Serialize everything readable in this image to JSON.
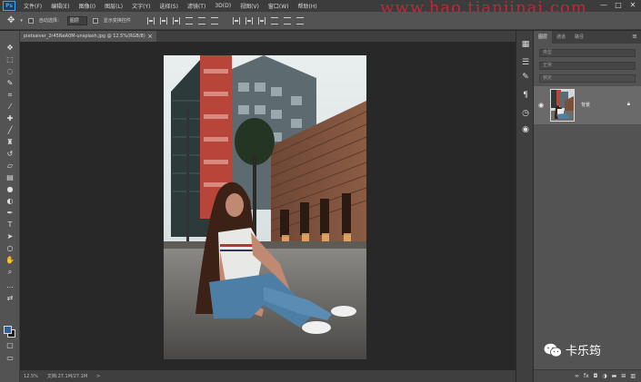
{
  "menubar": {
    "logo": "Ps",
    "items": [
      "文件(F)",
      "编辑(E)",
      "图像(I)",
      "图层(L)",
      "文字(Y)",
      "选择(S)",
      "滤镜(T)",
      "3D(D)",
      "视图(V)",
      "窗口(W)",
      "帮助(H)"
    ],
    "watermark": "www.hao.tianjinai.com",
    "window_controls": [
      "—",
      "□",
      "✕"
    ]
  },
  "options": {
    "auto_select_label": "自动选择：",
    "auto_select_value": "图层",
    "show_transform_label": "显示变换控件"
  },
  "document": {
    "tab_title": "pietsaiver_2r45NeA0M-unsplash.jpg @ 12.5%(RGB/8)",
    "tab_close": "×"
  },
  "statusbar": {
    "zoom": "12.5%",
    "doc_info": "文档:27.1M/27.1M",
    "arrow": ">"
  },
  "panel": {
    "tabs": [
      "图层",
      "通道",
      "路径"
    ],
    "active_tab": 0,
    "menu_glyph": "≡",
    "filter_placeholder": "类型",
    "mode_placeholder": "正常",
    "lock_label": "锁定",
    "layer_name": "背景",
    "bottom_icons": [
      "link-icon",
      "fx-icon",
      "mask-icon",
      "adjustment-icon",
      "folder-icon",
      "new-layer-icon",
      "trash-icon"
    ]
  },
  "wechat": {
    "name": "卡乐筠"
  },
  "colors": {
    "foreground": "#2f5f9e",
    "background": "#1e1e1e",
    "accent": "#31a8ff",
    "watermark": "#d8243a"
  }
}
